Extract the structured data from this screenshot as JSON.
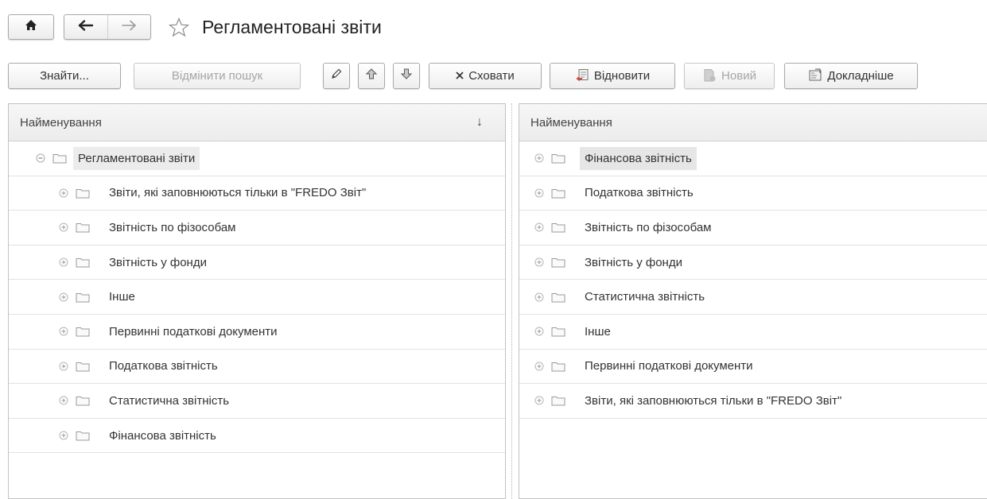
{
  "window": {
    "title": "Регламентовані звіти",
    "home_icon": "home-icon",
    "back_icon": "back-arrow-icon",
    "forward_icon": "forward-arrow-icon",
    "favorite_icon": "star-icon"
  },
  "toolbar": {
    "find_label": "Знайти...",
    "cancel_search_label": "Відмінити пошук",
    "hide_label": "Сховати",
    "restore_label": "Відновити",
    "new_label": "Новий",
    "details_label": "Докладніше"
  },
  "left_panel": {
    "column_header": "Найменування",
    "sort_indicator": "↓",
    "root": {
      "label": "Регламентовані звіти",
      "state": "collapse"
    },
    "items": [
      {
        "label": "Звіти, які заповнюються тільки в \"FREDO Звіт\""
      },
      {
        "label": "Звітність по фізособам"
      },
      {
        "label": "Звітність у фонди"
      },
      {
        "label": "Інше"
      },
      {
        "label": "Первинні податкові документи"
      },
      {
        "label": "Податкова звітність"
      },
      {
        "label": "Статистична звітність"
      },
      {
        "label": "Фінансова звітність"
      }
    ]
  },
  "right_panel": {
    "column_header": "Найменування",
    "items": [
      {
        "label": "Фінансова звітність",
        "selected": true
      },
      {
        "label": "Податкова звітність"
      },
      {
        "label": "Звітність по фізособам"
      },
      {
        "label": "Звітність у фонди"
      },
      {
        "label": "Статистична звітність"
      },
      {
        "label": "Інше"
      },
      {
        "label": "Первинні податкові документи"
      },
      {
        "label": "Звіти, які заповнюються тільки в \"FREDO Звіт\""
      }
    ]
  },
  "colors": {
    "selection": "#e6e6e6",
    "border": "#c2c2c2",
    "disabled_text": "#a6a6a6"
  }
}
